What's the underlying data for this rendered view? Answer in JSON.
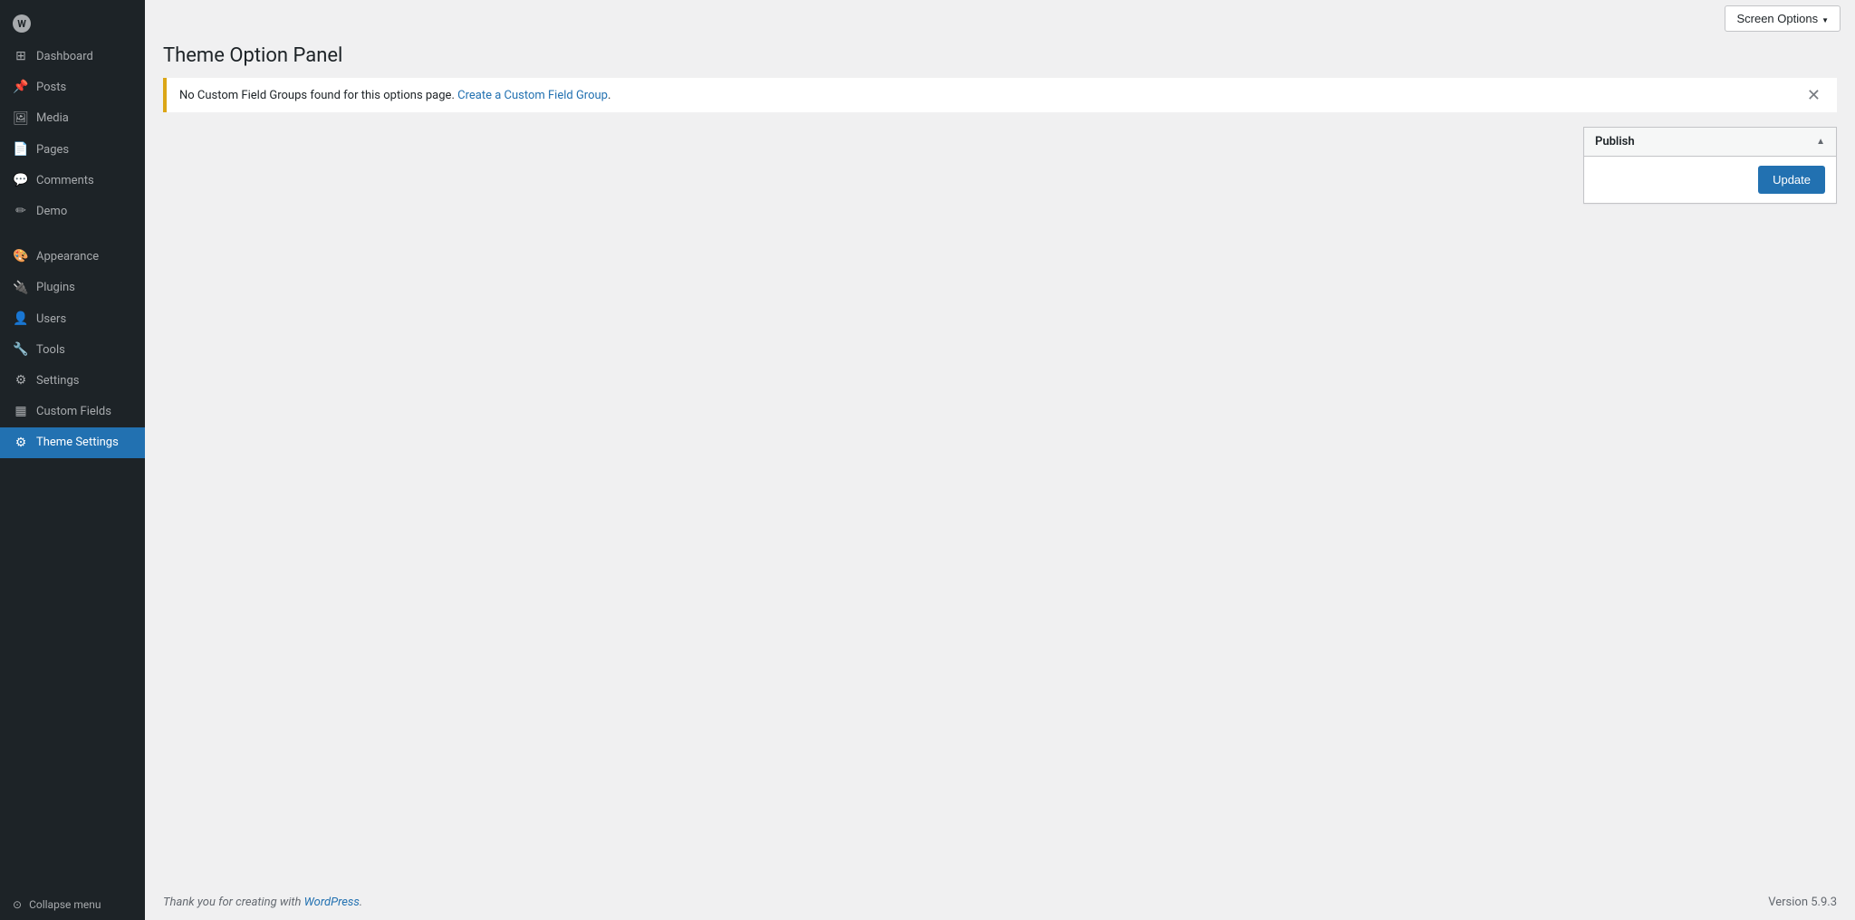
{
  "sidebar": {
    "logo_text": "W",
    "items": [
      {
        "id": "dashboard",
        "label": "Dashboard",
        "icon": "🏠"
      },
      {
        "id": "posts",
        "label": "Posts",
        "icon": "📌"
      },
      {
        "id": "media",
        "label": "Media",
        "icon": "🖼"
      },
      {
        "id": "pages",
        "label": "Pages",
        "icon": "📄"
      },
      {
        "id": "comments",
        "label": "Comments",
        "icon": "💬"
      },
      {
        "id": "demo",
        "label": "Demo",
        "icon": "📐"
      },
      {
        "id": "appearance",
        "label": "Appearance",
        "icon": "🎨"
      },
      {
        "id": "plugins",
        "label": "Plugins",
        "icon": "🔌"
      },
      {
        "id": "users",
        "label": "Users",
        "icon": "👤"
      },
      {
        "id": "tools",
        "label": "Tools",
        "icon": "🔧"
      },
      {
        "id": "settings",
        "label": "Settings",
        "icon": "⚙"
      },
      {
        "id": "custom-fields",
        "label": "Custom Fields",
        "icon": "▦"
      },
      {
        "id": "theme-settings",
        "label": "Theme Settings",
        "icon": "⚙"
      }
    ],
    "collapse_label": "Collapse menu"
  },
  "topbar": {
    "screen_options_label": "Screen Options"
  },
  "page": {
    "title": "Theme Option Panel"
  },
  "notice": {
    "text_before_link": "No Custom Field Groups found for this options page. ",
    "link_text": "Create a Custom Field Group",
    "text_after_link": "."
  },
  "publish_box": {
    "header_label": "Publish",
    "update_button_label": "Update"
  },
  "footer": {
    "thank_you_text": "Thank you for creating with ",
    "wp_link_text": "WordPress",
    "version_label": "Version 5.9.3"
  }
}
